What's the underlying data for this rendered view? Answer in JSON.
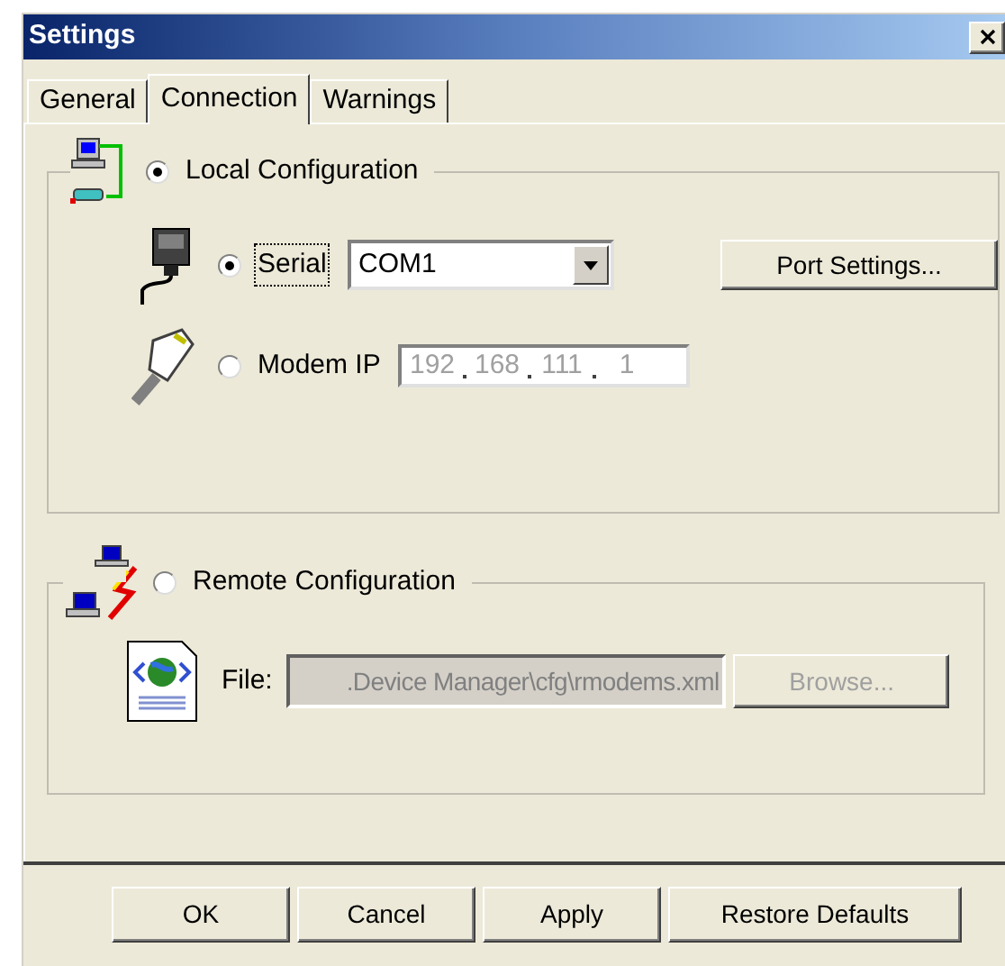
{
  "window": {
    "title": "Settings"
  },
  "tabs": [
    {
      "label": "General",
      "selected": false
    },
    {
      "label": "Connection",
      "selected": true
    },
    {
      "label": "Warnings",
      "selected": false
    }
  ],
  "local": {
    "label": "Local Configuration",
    "selected": true,
    "serial": {
      "label": "Serial",
      "selected": true,
      "focused": true,
      "port": "COM1",
      "button": "Port Settings..."
    },
    "modem": {
      "label": "Modem IP",
      "selected": false,
      "ip": [
        "192",
        "168",
        "111",
        "1"
      ],
      "disabled": true
    }
  },
  "remote": {
    "label": "Remote Configuration",
    "selected": false,
    "file_label": "File:",
    "file": ".Device Manager\\cfg\\rmodems.xml",
    "disabled": true,
    "browse": "Browse..."
  },
  "buttons": [
    "OK",
    "Cancel",
    "Apply",
    "Restore Defaults"
  ]
}
